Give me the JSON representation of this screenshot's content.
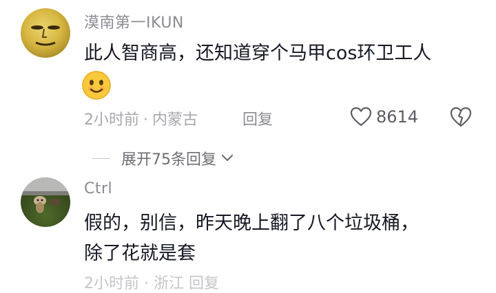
{
  "comments": [
    {
      "username": "漠南第一IKUN",
      "text_line1": "此人智商高，还知道穿个马甲cos环卫工人",
      "emoji": "smiling-face-emoji",
      "time": "2小时前",
      "location": "内蒙古",
      "reply_label": "回复",
      "likes": "8614",
      "expand_replies": "展开75条回复"
    },
    {
      "username": "Ctrl",
      "text_line1": "假的，别信，昨天晚上翻了八个垃圾桶，",
      "text_line2": "除了花就是套",
      "meta_partial": "2小时前 · 浙江  回复"
    }
  ],
  "icons": {
    "like": "heart-outline-icon",
    "dislike": "broken-heart-icon",
    "expand": "chevron-down-icon"
  },
  "colors": {
    "primary_text": "#161823",
    "secondary_text": "#8a8b91",
    "meta_text": "#a7a8ad"
  }
}
